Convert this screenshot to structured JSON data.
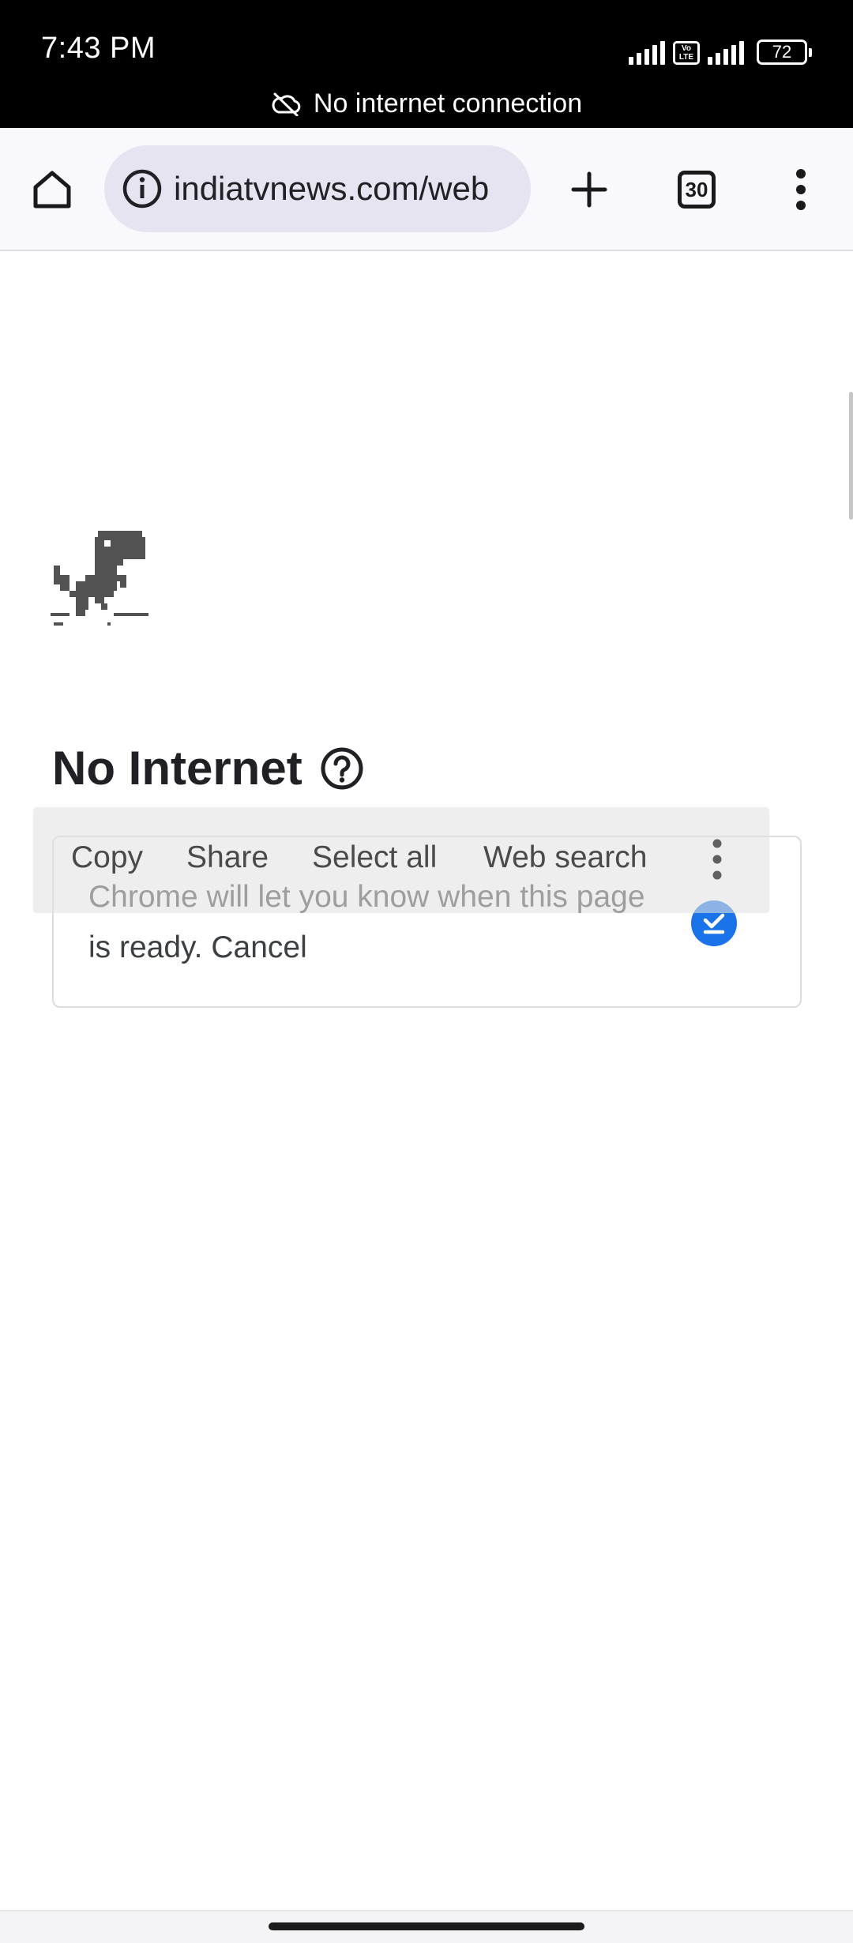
{
  "status_bar": {
    "time": "7:43 PM",
    "volte_label": "Vo LTE",
    "battery_level": "72",
    "offline_message": "No internet connection"
  },
  "toolbar": {
    "url": "indiatvnews.com/web",
    "tab_count": "30"
  },
  "page": {
    "title": "No Internet",
    "card_text": "Chrome will let you know when this page is ready.",
    "cancel_label": "Cancel",
    "notify_enabled": true
  },
  "selection_menu": {
    "items": [
      "Copy",
      "Share",
      "Select all",
      "Web search"
    ]
  },
  "colors": {
    "accent": "#1a73e8",
    "status_bar_bg": "#000000",
    "toolbar_bg": "#f8f8fd",
    "omnibox_bg": "#e5e4f0"
  },
  "icons": {
    "home": "home-icon",
    "info": "info-icon",
    "new_tab": "plus-icon",
    "menu": "more-vert-icon",
    "help": "help-circle-icon",
    "offline": "cloud-off-icon",
    "dino": "dino-icon"
  }
}
